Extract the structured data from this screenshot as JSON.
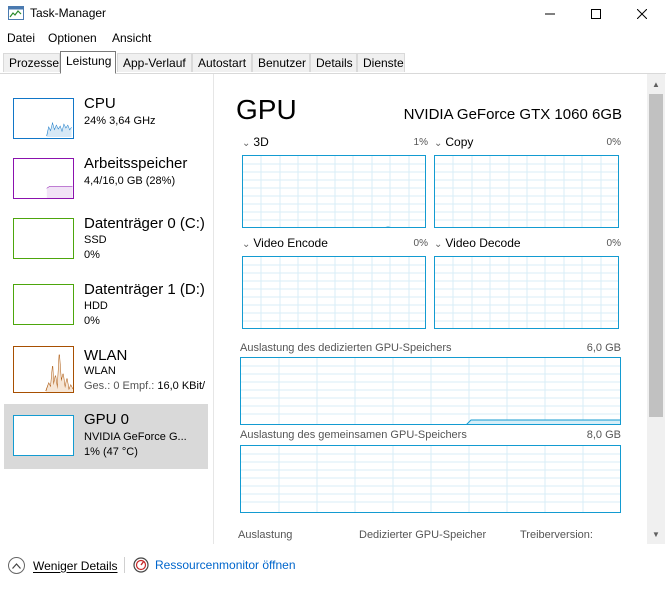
{
  "window": {
    "title": "Task-Manager",
    "minimize": "—",
    "maximize": "☐",
    "close": "✕"
  },
  "menu": [
    "Datei",
    "Optionen",
    "Ansicht"
  ],
  "tabs": [
    "Prozesse",
    "Leistung",
    "App-Verlauf",
    "Autostart",
    "Benutzer",
    "Details",
    "Dienste"
  ],
  "active_tab": "Leistung",
  "sidebar": {
    "items": [
      {
        "title": "CPU",
        "line1": "24%  3,64 GHz",
        "line2": "",
        "color": "#1176c7"
      },
      {
        "title": "Arbeitsspeicher",
        "line1": "4,4/16,0 GB (28%)",
        "line2": "",
        "color": "#8b12ae"
      },
      {
        "title": "Datenträger 0 (C:)",
        "line1": "SSD",
        "line2": "0%",
        "color": "#4da60c"
      },
      {
        "title": "Datenträger 1 (D:)",
        "line1": "HDD",
        "line2": "0%",
        "color": "#4da60c"
      },
      {
        "title": "WLAN",
        "line1": "WLAN",
        "line2_prefix": "Ges.: 0 Empf.: ",
        "line2": "16,0 KBit/",
        "color": "#a74f01"
      },
      {
        "title": "GPU 0",
        "line1": "NVIDIA GeForce G...",
        "line2": "1% (47 °C)",
        "color": "#139bd1"
      }
    ],
    "selected_index": 5
  },
  "gpu": {
    "header": "GPU",
    "model": "NVIDIA GeForce GTX 1060 6GB",
    "engines": [
      {
        "name": "3D",
        "percent": "1%"
      },
      {
        "name": "Copy",
        "percent": "0%"
      },
      {
        "name": "Video Encode",
        "percent": "0%"
      },
      {
        "name": "Video Decode",
        "percent": "0%"
      }
    ],
    "dedicated_label": "Auslastung des dedizierten GPU-Speichers",
    "dedicated_value": "6,0 GB",
    "shared_label": "Auslastung des gemeinsamen GPU-Speichers",
    "shared_value": "8,0 GB",
    "bottom": {
      "usage": "Auslastung",
      "dedicated": "Dedizierter GPU-Speicher",
      "driver": "Treiberversion:"
    },
    "accent": "#139bd1"
  },
  "footer": {
    "less_details": "Weniger Details",
    "resource_monitor": "Ressourcenmonitor öffnen"
  }
}
